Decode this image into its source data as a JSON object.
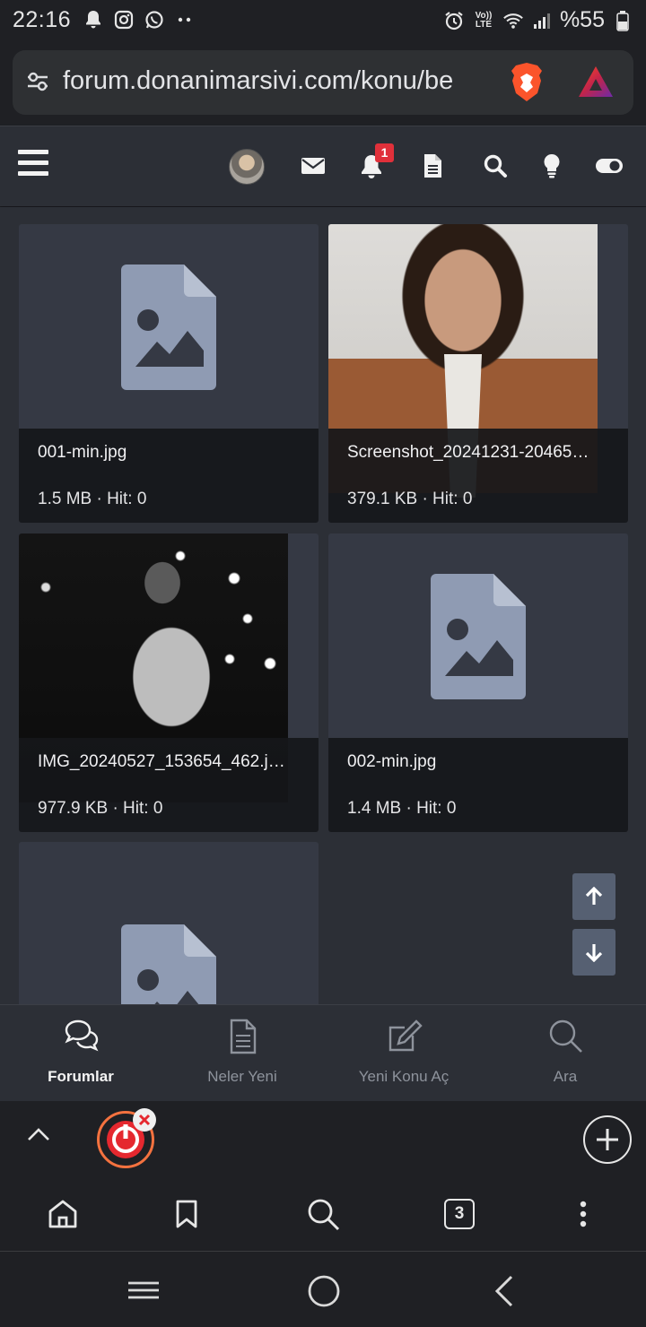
{
  "status_bar": {
    "time": "22:16",
    "battery": "%55",
    "icons": [
      "bell-icon",
      "instagram-icon",
      "whatsapp-icon",
      "more-dots-icon",
      "alarm-icon",
      "volte-icon",
      "wifi-icon",
      "signal-icon",
      "battery-icon"
    ],
    "volte_top": "Vo))",
    "volte_bottom": "LTE"
  },
  "browser": {
    "url": "forum.donanimarsivi.com/konu/be",
    "tab_count": "3"
  },
  "header": {
    "notification_count": "1",
    "icons": [
      "menu-icon",
      "avatar",
      "mail-icon",
      "bell-icon",
      "document-icon",
      "search-icon",
      "lightbulb-icon",
      "toggle-icon"
    ]
  },
  "attachments": [
    {
      "filename": "001-min.jpg",
      "info": "1.5 MB · Hit: 0",
      "thumb": "placeholder"
    },
    {
      "filename": "Screenshot_20241231-20465…",
      "info": "379.1 KB · Hit: 0",
      "thumb": "photo-man-suit"
    },
    {
      "filename": "IMG_20240527_153654_462.j…",
      "info": "977.9 KB · Hit: 0",
      "thumb": "photo-man-bw"
    },
    {
      "filename": "002-min.jpg",
      "info": "1.4 MB · Hit: 0",
      "thumb": "placeholder"
    },
    {
      "filename": "",
      "info": "",
      "thumb": "placeholder"
    }
  ],
  "forum_nav": [
    {
      "label": "Forumlar",
      "icon": "chat-bubbles-icon",
      "active": true
    },
    {
      "label": "Neler Yeni",
      "icon": "document-lines-icon",
      "active": false
    },
    {
      "label": "Yeni Konu Aç",
      "icon": "edit-icon",
      "active": false
    },
    {
      "label": "Ara",
      "icon": "search-icon",
      "active": false
    }
  ],
  "colors": {
    "background": "#2c2f36",
    "card": "#353944",
    "placeholder_icon": "#8f9bb3",
    "badge": "#e0303a",
    "scroll_button": "#566072"
  }
}
